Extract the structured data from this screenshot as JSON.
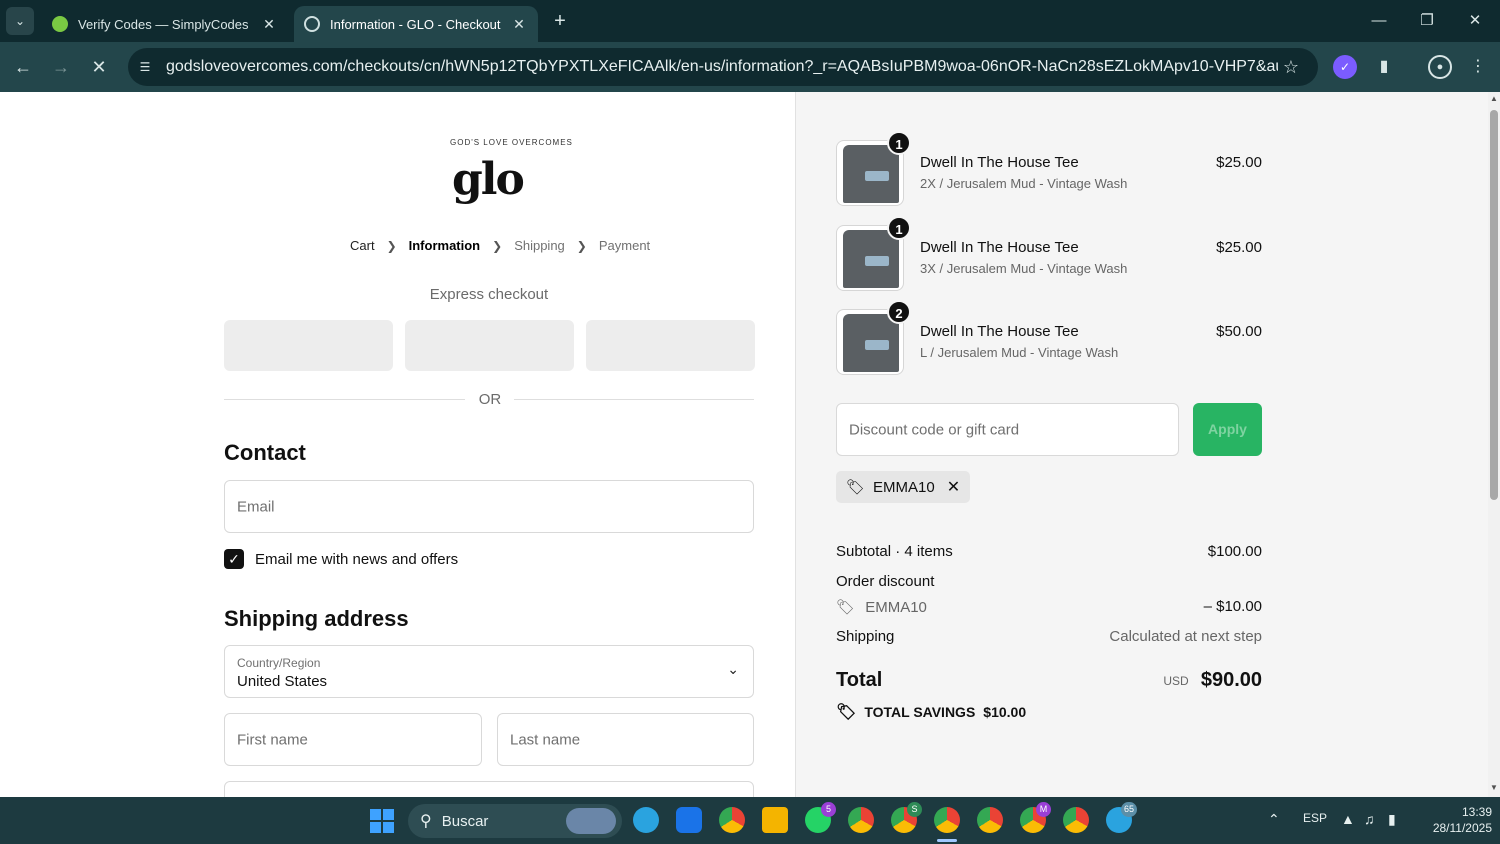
{
  "browser": {
    "tabs": [
      {
        "title": "Verify Codes — SimplyCodes",
        "favicon_color": "#7ac943",
        "active": false
      },
      {
        "title": "Information - GLO - Checkout",
        "favicon_color": "#cfe0e0",
        "active": true
      }
    ],
    "url": "godsloveovercomes.com/checkouts/cn/hWN5p12TQbYPXTLXeFICAAlk/en-us/information?_r=AQABsIuPBM9woa-06nOR-NaCn28sEZLokMApv10-VHP7&auto_redirect=..."
  },
  "store": {
    "logo_text": "glo",
    "logo_arc_text": "GOD'S LOVE OVERCOMES"
  },
  "breadcrumb": {
    "cart": "Cart",
    "information": "Information",
    "shipping": "Shipping",
    "payment": "Payment"
  },
  "express": {
    "title": "Express checkout",
    "or": "OR"
  },
  "contact": {
    "heading": "Contact",
    "email_placeholder": "Email",
    "newsletter_label": "Email me with news and offers",
    "newsletter_checked": true
  },
  "shipping_address": {
    "heading": "Shipping address",
    "country_label": "Country/Region",
    "country_value": "United States",
    "first_name_placeholder": "First name",
    "last_name_placeholder": "Last name"
  },
  "order": {
    "items": [
      {
        "quantity": "1",
        "name": "Dwell In The House Tee",
        "variant": "2X / Jerusalem Mud - Vintage Wash",
        "price": "$25.00"
      },
      {
        "quantity": "1",
        "name": "Dwell In The House Tee",
        "variant": "3X / Jerusalem Mud - Vintage Wash",
        "price": "$25.00"
      },
      {
        "quantity": "2",
        "name": "Dwell In The House Tee",
        "variant": "L / Jerusalem Mud - Vintage Wash",
        "price": "$50.00"
      }
    ],
    "discount_placeholder": "Discount code or gift card",
    "apply_label": "Apply",
    "applied_code": "EMMA10",
    "subtotal_label": "Subtotal · 4 items",
    "subtotal_value": "$100.00",
    "order_discount_label": "Order discount",
    "discount_code": "EMMA10",
    "discount_value": "– $10.00",
    "shipping_label": "Shipping",
    "shipping_value": "Calculated at next step",
    "total_label": "Total",
    "currency": "USD",
    "total_value": "$90.00",
    "savings_label": "TOTAL SAVINGS",
    "savings_value": "$10.00"
  },
  "taskbar": {
    "search_label": "Buscar",
    "language": "ESP",
    "time": "13:39",
    "date": "28/11/2025",
    "badges": {
      "whatsapp": "5",
      "chrome_s": "S",
      "chrome_m": "M",
      "telegram": "65"
    }
  },
  "colors": {
    "apply_button": "#28b463",
    "chrome_dark": "#0f2a2f",
    "chrome_toolbar": "#23464b"
  }
}
